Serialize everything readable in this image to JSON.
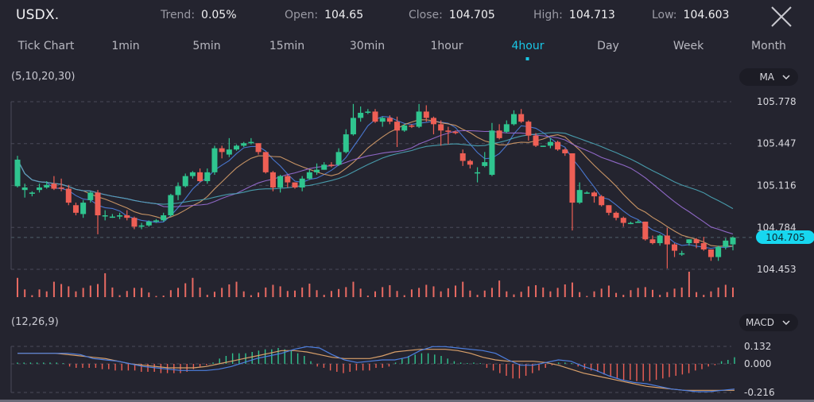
{
  "header": {
    "symbol": "USDX.",
    "stats": [
      {
        "label": "Trend:",
        "value": "0.05%"
      },
      {
        "label": "Open:",
        "value": "104.65"
      },
      {
        "label": "Close:",
        "value": "104.705"
      },
      {
        "label": "High:",
        "value": "104.713"
      },
      {
        "label": "Low:",
        "value": "104.603"
      }
    ],
    "close_icon": "close-x-icon"
  },
  "tabs": [
    {
      "label": "Tick Chart",
      "active": false
    },
    {
      "label": "1min",
      "active": false
    },
    {
      "label": "5min",
      "active": false
    },
    {
      "label": "15min",
      "active": false
    },
    {
      "label": "30min",
      "active": false
    },
    {
      "label": "1hour",
      "active": false
    },
    {
      "label": "4hour",
      "active": true
    },
    {
      "label": "Day",
      "active": false
    },
    {
      "label": "Week",
      "active": false
    },
    {
      "label": "Month",
      "active": false
    }
  ],
  "main_panel": {
    "params": "(5,10,20,30)",
    "indicator_select": "MA",
    "current_price_tag": "104.705"
  },
  "macd_panel": {
    "params": "(12,26,9)",
    "indicator_select": "MACD"
  },
  "colors": {
    "background": "#24242f",
    "up": "#2fc58f",
    "down": "#ee5f55",
    "accent": "#19c7e6",
    "ma5": "#4d7fe0",
    "ma10": "#d9a06a",
    "ma20": "#9a6fd6",
    "ma30": "#4ba7b8",
    "volume": "#e86a62",
    "macd_dif": "#4d7fe0",
    "macd_dea": "#d9a06a"
  },
  "chart_data": [
    {
      "type": "candlestick",
      "title": "USDX. 4hour",
      "indicator": "MA (5,10,20,30)",
      "y_ticks": [
        "105.778",
        "105.447",
        "105.116",
        "104.784",
        "104.453"
      ],
      "ylim": [
        104.4,
        105.8
      ],
      "grid": true,
      "last_price": 104.705,
      "ohlc": [
        [
          105.11,
          105.32,
          105.1,
          105.35,
          105.1
        ],
        [
          105.08,
          105.1,
          105.03,
          105.13,
          105.02
        ],
        [
          105.05,
          105.06,
          105.04,
          105.07,
          105.03
        ],
        [
          105.08,
          105.1,
          105.07,
          105.13,
          105.06
        ],
        [
          105.1,
          105.12,
          105.09,
          105.15,
          105.09
        ],
        [
          105.13,
          105.09,
          105.08,
          105.19,
          105.08
        ],
        [
          105.1,
          105.09,
          105.08,
          105.17,
          105.07
        ],
        [
          105.09,
          104.98,
          104.96,
          105.12,
          104.96
        ],
        [
          104.96,
          104.9,
          104.89,
          104.98,
          104.88
        ],
        [
          104.89,
          104.98,
          104.87,
          105.0,
          104.86
        ],
        [
          105.0,
          105.06,
          104.99,
          105.07,
          104.98
        ],
        [
          105.06,
          104.88,
          104.73,
          105.08,
          104.73
        ],
        [
          104.88,
          104.88,
          104.86,
          104.92,
          104.84
        ],
        [
          104.87,
          104.87,
          104.87,
          104.89,
          104.86
        ],
        [
          104.87,
          104.88,
          104.86,
          104.9,
          104.85
        ],
        [
          104.88,
          104.86,
          104.84,
          104.92,
          104.84
        ],
        [
          104.86,
          104.79,
          104.78,
          104.87,
          104.77
        ],
        [
          104.79,
          104.8,
          104.78,
          104.82,
          104.77
        ],
        [
          104.8,
          104.83,
          104.8,
          104.84,
          104.79
        ],
        [
          104.83,
          104.84,
          104.82,
          104.85,
          104.82
        ],
        [
          104.84,
          104.88,
          104.83,
          104.9,
          104.83
        ],
        [
          104.88,
          105.04,
          104.87,
          105.05,
          104.87
        ],
        [
          105.04,
          105.11,
          105.0,
          105.14,
          105.0
        ],
        [
          105.11,
          105.19,
          105.1,
          105.21,
          105.1
        ],
        [
          105.19,
          105.22,
          105.18,
          105.23,
          105.17
        ],
        [
          105.22,
          105.15,
          105.14,
          105.25,
          105.14
        ],
        [
          105.15,
          105.22,
          105.14,
          105.25,
          105.13
        ],
        [
          105.22,
          105.41,
          105.21,
          105.43,
          105.2
        ],
        [
          105.41,
          105.38,
          105.33,
          105.43,
          105.33
        ],
        [
          105.36,
          105.4,
          105.35,
          105.49,
          105.34
        ],
        [
          105.4,
          105.43,
          105.39,
          105.44,
          105.39
        ],
        [
          105.43,
          105.45,
          105.42,
          105.46,
          105.42
        ],
        [
          105.45,
          105.46,
          105.44,
          105.49,
          105.44
        ],
        [
          105.45,
          105.38,
          105.37,
          105.45,
          105.36
        ],
        [
          105.38,
          105.22,
          105.21,
          105.38,
          105.21
        ],
        [
          105.22,
          105.1,
          105.07,
          105.23,
          105.07
        ],
        [
          105.1,
          105.19,
          105.06,
          105.2,
          105.06
        ],
        [
          105.19,
          105.14,
          105.1,
          105.2,
          105.1
        ],
        [
          105.14,
          105.1,
          105.09,
          105.14,
          105.09
        ],
        [
          105.1,
          105.17,
          105.07,
          105.19,
          105.07
        ],
        [
          105.17,
          105.22,
          105.16,
          105.24,
          105.16
        ],
        [
          105.22,
          105.24,
          105.21,
          105.29,
          105.2
        ],
        [
          105.24,
          105.28,
          105.24,
          105.3,
          105.24
        ],
        [
          105.28,
          105.27,
          105.27,
          105.3,
          105.26
        ],
        [
          105.28,
          105.38,
          105.27,
          105.41,
          105.27
        ],
        [
          105.38,
          105.52,
          105.37,
          105.56,
          105.37
        ],
        [
          105.52,
          105.65,
          105.51,
          105.76,
          105.51
        ],
        [
          105.65,
          105.69,
          105.63,
          105.74,
          105.62
        ],
        [
          105.69,
          105.7,
          105.68,
          105.72,
          105.68
        ],
        [
          105.7,
          105.62,
          105.61,
          105.72,
          105.61
        ],
        [
          105.62,
          105.65,
          105.58,
          105.66,
          105.58
        ],
        [
          105.65,
          105.62,
          105.61,
          105.67,
          105.6
        ],
        [
          105.62,
          105.55,
          105.42,
          105.66,
          105.42
        ],
        [
          105.55,
          105.59,
          105.54,
          105.6,
          105.54
        ],
        [
          105.59,
          105.58,
          105.57,
          105.6,
          105.57
        ],
        [
          105.58,
          105.7,
          105.57,
          105.76,
          105.57
        ],
        [
          105.7,
          105.65,
          105.62,
          105.75,
          105.62
        ],
        [
          105.65,
          105.6,
          105.52,
          105.66,
          105.52
        ],
        [
          105.6,
          105.55,
          105.43,
          105.63,
          105.43
        ],
        [
          105.55,
          105.54,
          105.44,
          105.58,
          105.44
        ],
        [
          105.54,
          105.53,
          105.52,
          105.55,
          105.52
        ],
        [
          105.37,
          105.31,
          105.27,
          105.4,
          105.27
        ],
        [
          105.31,
          105.28,
          105.25,
          105.32,
          105.25
        ],
        [
          105.22,
          105.22,
          105.14,
          105.26,
          105.14
        ],
        [
          105.27,
          105.3,
          105.26,
          105.38,
          105.26
        ],
        [
          105.2,
          105.55,
          105.19,
          105.61,
          105.19
        ],
        [
          105.55,
          105.49,
          105.48,
          105.6,
          105.48
        ],
        [
          105.54,
          105.6,
          105.53,
          105.63,
          105.53
        ],
        [
          105.6,
          105.68,
          105.59,
          105.71,
          105.59
        ],
        [
          105.68,
          105.62,
          105.61,
          105.72,
          105.61
        ],
        [
          105.62,
          105.51,
          105.48,
          105.63,
          105.47
        ],
        [
          105.51,
          105.43,
          105.42,
          105.53,
          105.42
        ],
        [
          105.43,
          105.43,
          105.42,
          105.43,
          105.42
        ],
        [
          105.43,
          105.46,
          105.42,
          105.49,
          105.41
        ],
        [
          105.46,
          105.4,
          105.39,
          105.47,
          105.39
        ],
        [
          105.4,
          105.37,
          105.36,
          105.41,
          105.35
        ],
        [
          105.37,
          104.98,
          104.94,
          105.37,
          104.76
        ],
        [
          104.98,
          105.08,
          104.97,
          105.14,
          104.97
        ],
        [
          105.06,
          105.06,
          105.05,
          105.07,
          105.05
        ],
        [
          105.06,
          105.03,
          104.98,
          105.07,
          104.98
        ],
        [
          105.03,
          104.96,
          104.95,
          105.04,
          104.95
        ],
        [
          104.96,
          104.9,
          104.88,
          104.96,
          104.88
        ],
        [
          104.9,
          104.86,
          104.84,
          104.91,
          104.84
        ],
        [
          104.86,
          104.82,
          104.79,
          104.87,
          104.79
        ],
        [
          104.82,
          104.82,
          104.81,
          104.83,
          104.81
        ],
        [
          104.82,
          104.83,
          104.82,
          104.84,
          104.82
        ],
        [
          104.83,
          104.69,
          104.68,
          104.83,
          104.68
        ],
        [
          104.69,
          104.66,
          104.65,
          104.72,
          104.65
        ],
        [
          104.66,
          104.72,
          104.65,
          104.73,
          104.64
        ],
        [
          104.72,
          104.65,
          104.5,
          104.78,
          104.46
        ],
        [
          104.65,
          104.6,
          104.55,
          104.66,
          104.55
        ],
        [
          104.57,
          104.58,
          104.57,
          104.6,
          104.56
        ],
        [
          104.66,
          104.69,
          104.64,
          104.69,
          104.64
        ],
        [
          104.69,
          104.66,
          104.64,
          104.7,
          104.62
        ],
        [
          104.66,
          104.61,
          104.6,
          104.71,
          104.6
        ],
        [
          104.61,
          104.55,
          104.53,
          104.61,
          104.52
        ],
        [
          104.55,
          104.63,
          104.52,
          104.64,
          104.52
        ],
        [
          104.63,
          104.68,
          104.62,
          104.7,
          104.61
        ],
        [
          104.65,
          104.705,
          104.603,
          104.713,
          104.603
        ]
      ],
      "ohlc_format": "each row: [open, close, low, high, low] approximated; use [0]=open,[1]=close,[3]=high,[4]=low",
      "volume": [
        5,
        2,
        0.5,
        2,
        1.5,
        4,
        3.4,
        2.8,
        1.5,
        2.4,
        3,
        3.4,
        6.2,
        2.5,
        0.5,
        1.6,
        2.4,
        2.4,
        1.2,
        0.3,
        0.4,
        1.8,
        2.4,
        3.6,
        5,
        2.5,
        0.6,
        1.4,
        2.4,
        3.3,
        4,
        1.5,
        0.5,
        1.2,
        2.5,
        3.2,
        2.8,
        1.6,
        1.7,
        2.5,
        3.5,
        1.8,
        0.6,
        1.6,
        2.1,
        2.6,
        4,
        2.2,
        0.4,
        1.5,
        2.6,
        3.1,
        1.6,
        0.5,
        2,
        2.4,
        3.2,
        2.8,
        1.5,
        2.3,
        3,
        4,
        1.7,
        0.6,
        1.7,
        2.4,
        4.3,
        1.5,
        0.7,
        1.4,
        2.8,
        3.1,
        2.5,
        1.5,
        2.4,
        3.3,
        3.8,
        1.3,
        0.3,
        1.5,
        2.2,
        3,
        1.1,
        0.6,
        1.8,
        2.4,
        2.6,
        1.9,
        0.6,
        1.3,
        2.2,
        2.5,
        6.6,
        1.3,
        0.6,
        1.5,
        2.5,
        3.2,
        2.5,
        1.5,
        0.7,
        0.9
      ],
      "ma_lines": [
        {
          "name": "MA5",
          "color": "ma5"
        },
        {
          "name": "MA10",
          "color": "ma10"
        },
        {
          "name": "MA20",
          "color": "ma20"
        },
        {
          "name": "MA30",
          "color": "ma30"
        }
      ]
    },
    {
      "type": "macd",
      "params": "(12,26,9)",
      "y_ticks": [
        "0.132",
        "0.000",
        "-0.216"
      ],
      "ylim": [
        -0.216,
        0.132
      ],
      "grid": true,
      "histogram": [
        0.01,
        0.01,
        0.01,
        0.01,
        0.01,
        0.01,
        0.01,
        0,
        -0.02,
        -0.03,
        -0.03,
        -0.03,
        -0.03,
        -0.04,
        -0.04,
        -0.05,
        -0.05,
        -0.05,
        -0.05,
        -0.06,
        -0.06,
        -0.06,
        -0.07,
        -0.07,
        -0.07,
        -0.07,
        -0.06,
        -0.04,
        -0.02,
        -0.01,
        0.01,
        0.04,
        0.06,
        0.08,
        0.08,
        0.08,
        0.09,
        0.1,
        0.11,
        0.11,
        0.12,
        0.11,
        0.1,
        0.08,
        0.06,
        0.02,
        -0.02,
        -0.03,
        -0.05,
        -0.06,
        -0.07,
        -0.06,
        -0.05,
        -0.05,
        -0.05,
        -0.03,
        -0.03,
        -0.02,
        0.01,
        0.04,
        0.06,
        0.07,
        0.08,
        0.08,
        0.07,
        0.06,
        0.04,
        0.02,
        0.01,
        0,
        0.01,
        0,
        -0.03,
        -0.05,
        -0.07,
        -0.09,
        -0.11,
        -0.11,
        -0.09,
        -0.07,
        -0.05,
        -0.03,
        -0.01,
        0.01,
        0.01,
        0,
        -0.02,
        -0.04,
        -0.05,
        -0.06,
        -0.08,
        -0.1,
        -0.11,
        -0.12,
        -0.12,
        -0.13,
        -0.13,
        -0.13,
        -0.12,
        -0.11,
        -0.1,
        -0.09,
        -0.08,
        -0.07,
        -0.05,
        -0.04,
        -0.02,
        -0.01,
        0.02,
        0.03,
        0.05
      ],
      "dif": [
        0.08,
        0.08,
        0.08,
        0.08,
        0.08,
        0.07,
        0.04,
        0.03,
        0.02,
        0,
        -0.02,
        -0.03,
        -0.04,
        -0.05,
        -0.05,
        -0.05,
        -0.04,
        -0.02,
        0.01,
        0.04,
        0.06,
        0.08,
        0.11,
        0.13,
        0.12,
        0.07,
        0.03,
        0.01,
        0.02,
        0.03,
        0.03,
        0.05,
        0.1,
        0.13,
        0.13,
        0.12,
        0.11,
        0.1,
        0.08,
        0.03,
        -0.01,
        -0.01,
        0.01,
        0.03,
        0.02,
        -0.02,
        -0.05,
        -0.09,
        -0.12,
        -0.14,
        -0.15,
        -0.17,
        -0.19,
        -0.2,
        -0.21,
        -0.21,
        -0.2,
        -0.19
      ],
      "dea": [
        0.08,
        0.08,
        0.08,
        0.08,
        0.07,
        0.06,
        0.05,
        0.04,
        0.02,
        0,
        -0.01,
        -0.02,
        -0.03,
        -0.03,
        -0.03,
        -0.02,
        0,
        0.02,
        0.04,
        0.06,
        0.08,
        0.1,
        0.1,
        0.09,
        0.07,
        0.05,
        0.04,
        0.04,
        0.04,
        0.06,
        0.09,
        0.1,
        0.11,
        0.11,
        0.11,
        0.1,
        0.08,
        0.05,
        0.03,
        0.02,
        0.02,
        0.02,
        0.01,
        -0.01,
        -0.04,
        -0.07,
        -0.09,
        -0.11,
        -0.13,
        -0.15,
        -0.17,
        -0.18,
        -0.19,
        -0.2,
        -0.2,
        -0.2,
        -0.2,
        -0.2
      ]
    }
  ]
}
